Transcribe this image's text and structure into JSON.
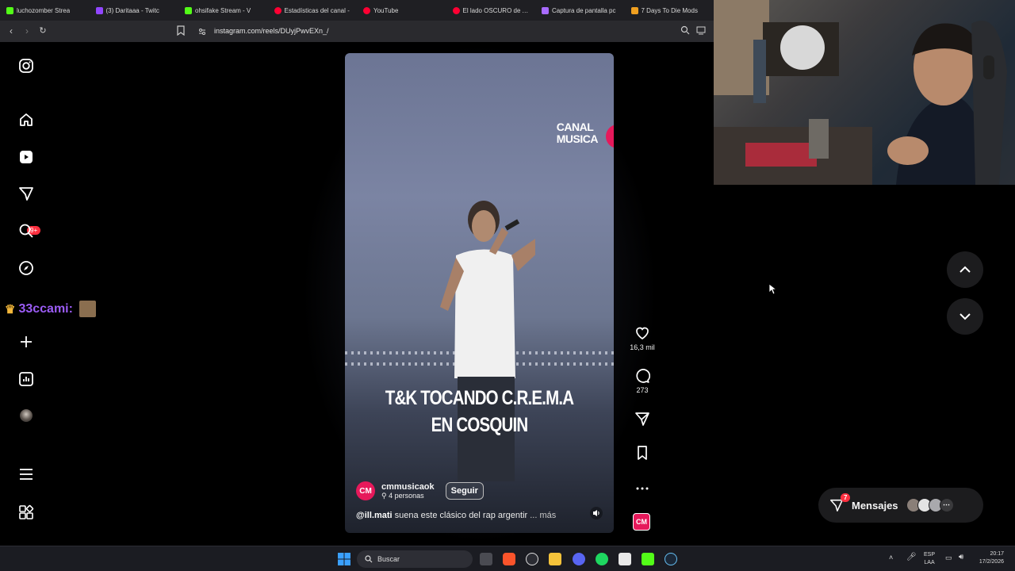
{
  "browser": {
    "tabs": [
      {
        "title": "luchozomber Strea",
        "color": "#53fc18"
      },
      {
        "title": "(3) Daritaaa - Twitc",
        "color": "#9146ff"
      },
      {
        "title": "ohsifake Stream - V",
        "color": "#53fc18"
      },
      {
        "title": "Estadísticas del canal -",
        "color": "#ff0033"
      },
      {
        "title": "YouTube",
        "color": "#ff0033"
      },
      {
        "title": "El lado OSCURO de AF",
        "color": "#ff0033"
      },
      {
        "title": "Captura de pantalla pc",
        "color": "#a86bff"
      },
      {
        "title": "7 Days To Die Mods",
        "color": "#f0a020"
      }
    ],
    "url": "instagram.com/reels/DUyjPwvEXn_/"
  },
  "sidebar": {
    "notifications_badge": "9+",
    "chat_overlay_name": "33ccami:"
  },
  "reel": {
    "watermark_line1": "CANAL",
    "watermark_line2": "MUSICA",
    "caption_line1": "T&K TOCANDO C.R.E.M.A",
    "caption_line2": "EN COSQUIN",
    "author_initials": "CM",
    "author_name": "cmmusicaok",
    "author_sub": "4 personas",
    "follow_label": "Seguir",
    "description_user": "@ill.mati",
    "description_text": "suena este clásico del rap argentir",
    "description_more": "... más"
  },
  "actions": {
    "likes": "16,3 mil",
    "comments": "273",
    "audio_initials": "CM"
  },
  "messages": {
    "label": "Mensajes",
    "badge": "7"
  },
  "taskbar": {
    "search_placeholder": "Buscar",
    "lang_line1": "ESP",
    "lang_line2": "LAA",
    "time": "20:17",
    "date": "17/2/2026"
  }
}
